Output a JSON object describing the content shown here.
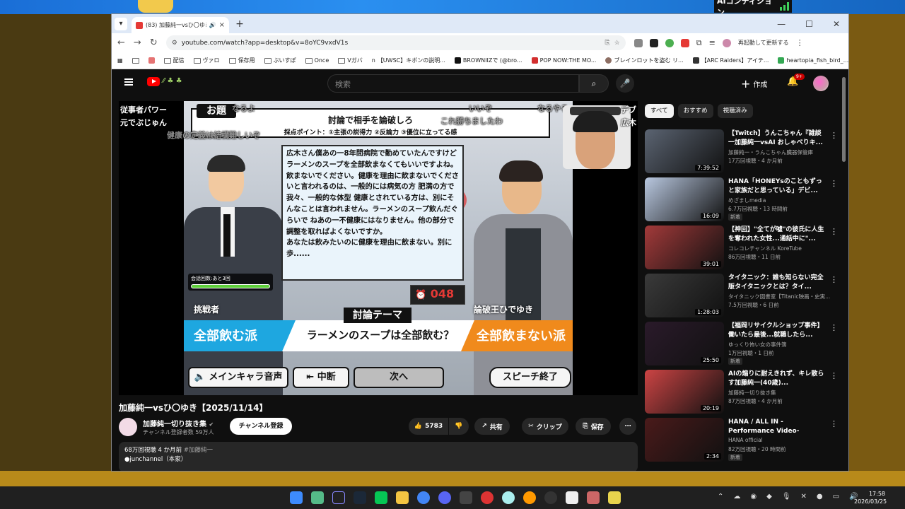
{
  "desktop": {
    "ai_badge": "AIコンディション",
    "clock_time": "17:58",
    "clock_date": "2026/03/25"
  },
  "browser": {
    "tab_title": "(83) 加藤純一vsひ〇ゆき【20...",
    "url": "youtube.com/watch?app=desktop&v=8oYC9vxdV1s",
    "translate_label": "再起動して更新する",
    "bookmarks": [
      "配信",
      "ヴァロ",
      "保存用",
      "ぶいすぽ",
      "Once",
      "Vガバ",
      "【UWSC】キボンの説明...",
      "BROWNIIZで (@bro...",
      "POP NOW:THE MO...",
      "ブレインロットを盗む リ...",
      "【ARC Raiders】アイテ...",
      "heartopia_fish_bird_..."
    ]
  },
  "youtube": {
    "search_placeholder": "検索",
    "create_label": "作成",
    "notif_count": "9+",
    "video": {
      "odai": "お題",
      "topic_title": "討論で相手を論破しろ",
      "topic_criteria": "採点ポイント：①主張の説得力 ②反論力 ③優位に立ってる感",
      "bubble_text": "広木さん僕あの一8年間病院で勤めていたんですけど ラーメンのスープを全部飲まなくてもいいですよね。 飲まないでください。健康を理由に飲まないでくださいと言われるのは、一般的には病気の方 肥満の方で 我々、一般的な体型 健康とされている方は、別にそんなことは言われません。ラーメンのスープ飲んだぐらいで ねあの一不健康にはなりません。他の部分で調整を取ればよくないですか。\nあなたは飲みたいのに健康を理由に飲まない。別に歩......",
      "life_label": "会話回数:あと3回",
      "life_level": 1.0,
      "timer": "048",
      "challenger": "挑戦者",
      "opponent": "論破王ひでゆき",
      "debate_label": "討論テーマ",
      "side_left": "全部飲む派",
      "side_right": "全部飲まない派",
      "theme": "ラーメンのスープは全部飲む？",
      "btn_voice": "メインキャラ音声",
      "btn_pause": "中断",
      "btn_next": "次へ",
      "btn_end": "スピーチ終了",
      "comments": [
        "従事者パワー",
        "元でぶじゅん",
        "なるよ",
        "健康の定義は結構難しいぞ",
        "これ勝ちましたわ",
        "いいぞ",
        "なるやろ",
        "デブ",
        "広木"
      ]
    },
    "title": "加藤純一vsひ〇ゆき【2025/11/14】",
    "channel_name": "加藤純一切り抜き集",
    "channel_subs": "チャンネル登録者数 59万人",
    "subscribe": "チャンネル登録",
    "likes": "5783",
    "share": "共有",
    "clip": "クリップ",
    "save": "保存",
    "desc_views": "68万回視聴 4 か月前",
    "desc_tag": "#加藤純一",
    "desc_line2": "●junchannel（本家）",
    "chips": [
      "すべて",
      "おすすめ",
      "視聴済み"
    ],
    "recs": [
      {
        "title": "【Twitch】うんこちゃん『雑談一加藤純一vsAI おしゃべりキ...",
        "channel": "加藤純一・うんこちゃん臓器保管庫",
        "meta": "17万回視聴・4 か月前",
        "dur": "7:39:52",
        "color": "#5b6472",
        "new": ""
      },
      {
        "title": "HANA「HONEYsのこともずっと家族だと思っている」デビ...",
        "channel": "めざましmedia",
        "meta": "6.7万回視聴・13 時間前",
        "dur": "16:09",
        "color": "#b9c8e0",
        "new": "新着"
      },
      {
        "title": "【神回】\"全てが嘘\"の彼氏に人生を奪われた女性...通話中に\"...",
        "channel": "コレコレチャンネル KoreTube",
        "meta": "86万回視聴・11 日前",
        "dur": "39:01",
        "color": "#a33a3a",
        "new": ""
      },
      {
        "title": "タイタニック：誰も知らない完全版タイタニックとは？タイ...",
        "channel": "タイタニック図書室【Titanic映画・史実...",
        "meta": "7.5万回視聴・6 日前",
        "dur": "1:28:03",
        "color": "#3a3a3a",
        "new": ""
      },
      {
        "title": "【福岡リサイクルショップ事件】働いたら最後...就職したら...",
        "channel": "ゆっくり怖い女の事件簿",
        "meta": "1万回視聴・1 日前",
        "dur": "25:50",
        "color": "#2a1a2a",
        "new": "新着"
      },
      {
        "title": "AIの煽りに耐えきれず、キレ散らす加藤純一(40歳)...",
        "channel": "加藤純一切り抜き集",
        "meta": "87万回視聴・4 か月前",
        "dur": "20:19",
        "color": "#c44",
        "new": ""
      },
      {
        "title": "HANA / ALL IN -Performance Video-",
        "channel": "HANA official",
        "meta": "82万回視聴・20 時間前",
        "dur": "2:34",
        "color": "#4a1a1a",
        "new": "新着"
      }
    ]
  },
  "colors": {
    "accent": "#ff0000",
    "left_side": "#1ea7e0",
    "right_side": "#f08a1c"
  }
}
